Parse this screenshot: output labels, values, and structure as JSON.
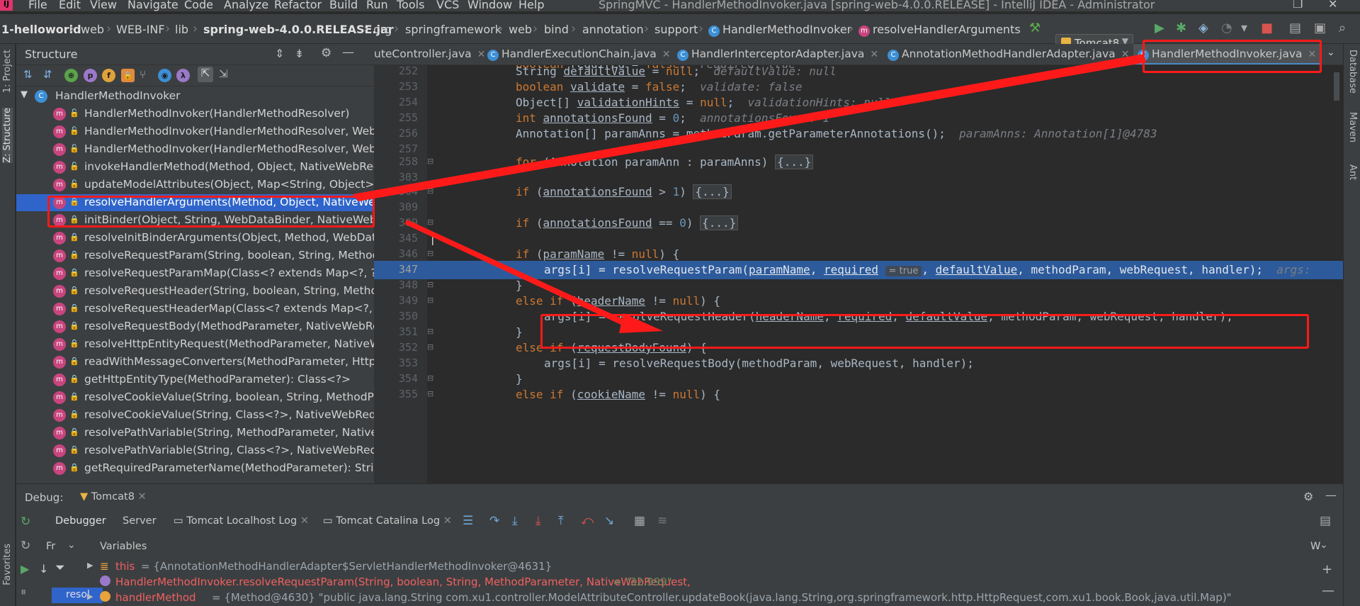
{
  "app": {
    "logo": "IJ",
    "window_title": "SpringMVC - HandlerMethodInvoker.java [spring-web-4.0.0.RELEASE] - IntelliJ IDEA - Administrator",
    "menu": [
      "File",
      "Edit",
      "View",
      "Navigate",
      "Code",
      "Analyze",
      "Refactor",
      "Build",
      "Run",
      "Tools",
      "VCS",
      "Window",
      "Help"
    ]
  },
  "breadcrumb": [
    "1-helloworld",
    "web",
    "WEB-INF",
    "lib",
    "spring-web-4.0.0.RELEASE.jar",
    "org",
    "springframework",
    "web",
    "bind",
    "annotation",
    "support",
    "HandlerMethodInvoker",
    "resolveHandlerArguments"
  ],
  "run_config": "Tomcat8",
  "sidebar_left": [
    "1: Project",
    "Z: Structure",
    "Favorites"
  ],
  "sidebar_right": [
    "Database",
    "Maven",
    "Ant"
  ],
  "structure": {
    "title": "Structure",
    "root": "HandlerMethodInvoker",
    "items": [
      "HandlerMethodInvoker(HandlerMethodResolver)",
      "HandlerMethodInvoker(HandlerMethodResolver, WebBi",
      "HandlerMethodInvoker(HandlerMethodResolver, WebBi",
      "invokeHandlerMethod(Method, Object, NativeWebReq",
      "updateModelAttributes(Object, Map<String, Object>,",
      "resolveHandlerArguments(Method, Object, NativeWeb",
      "initBinder(Object, String, WebDataBinder, NativeWebR",
      "resolveInitBinderArguments(Object, Method, WebData",
      "resolveRequestParam(String, boolean, String, MethodP",
      "resolveRequestParamMap(Class<? extends Map<?, ?>>",
      "resolveRequestHeader(String, boolean, String, Method",
      "resolveRequestHeaderMap(Class<? extends Map<?, ?>>",
      "resolveRequestBody(MethodParameter, NativeWebReq",
      "resolveHttpEntityRequest(MethodParameter, NativeWe",
      "readWithMessageConverters(MethodParameter, HttpIn",
      "getHttpEntityType(MethodParameter): Class<?>",
      "resolveCookieValue(String, boolean, String, MethodPar",
      "resolveCookieValue(String, Class<?>, NativeWebReque",
      "resolvePathVariable(String, MethodParameter, NativeW",
      "resolvePathVariable(String, Class<?>, NativeWebReque",
      "getRequiredParameterName(MethodParameter): String"
    ],
    "selected_index": 5
  },
  "tabs": [
    {
      "label": "uteController.java",
      "active": false
    },
    {
      "label": "HandlerExecutionChain.java",
      "active": false
    },
    {
      "label": "HandlerInterceptorAdapter.java",
      "active": false
    },
    {
      "label": "AnnotationMethodHandlerAdapter.java",
      "active": false
    },
    {
      "label": "HandlerMethodInvoker.java",
      "active": true
    }
  ],
  "editor": {
    "hint_required": "required: true",
    "line_numbers": [
      "252",
      "253",
      "254",
      "255",
      "256",
      "257",
      "258",
      "303",
      "304",
      "309",
      "309",
      "345",
      "346",
      "347",
      "348",
      "349",
      "350",
      "351",
      "352",
      "353",
      "354",
      "355"
    ],
    "inlay_true": "= true",
    "fold": "{...}",
    "hints": {
      "defaultValue": "defaultValue: null",
      "validate": "validate: false",
      "validationHints": "validationHints: null",
      "annotationsFound": "annotationsFound: 1",
      "paramAnns": "paramAnns: Annotation[1]@4783",
      "args": "args:"
    }
  },
  "debug": {
    "title": "Debug:",
    "session": "Tomcat8",
    "tabs": [
      "Debugger",
      "Server",
      "Tomcat Localhost Log",
      "Tomcat Catalina Log"
    ],
    "frames_label": "Fr",
    "variables_label": "Variables",
    "watches_label": "W",
    "frame_selected": "resol",
    "variables": [
      {
        "name": "this",
        "value": "= {AnnotationMethodHandlerAdapter$ServletHandlerMethodInvoker@4631}"
      },
      {
        "name": "HandlerMethodInvoker.resolveRequestParam(String, boolean, String, MethodParameter, NativeWebRequest,",
        "value": "= \"32.999\""
      },
      {
        "name": "handlerMethod",
        "value": "= {Method@4630} \"public java.lang.String com.xu1.controller.ModelAttributeController.updateBook(java.lang.String,org.springframework.http.HttpRequest,com.xu1.book.Book,java.util.Map)\""
      }
    ]
  },
  "colors": {
    "annotation_red": "#ff1a1a",
    "selection_blue": "#2f65ca",
    "debug_line_blue": "#2d5a9a",
    "keyword_orange": "#cc7832"
  }
}
